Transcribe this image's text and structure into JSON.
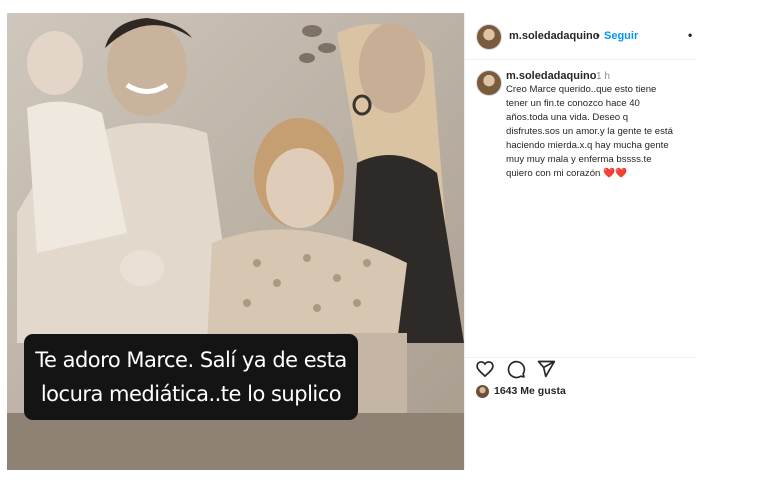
{
  "post": {
    "overlay_lines": [
      "Te adoro Marce. Salí ya de  esta",
      "locura mediática..te lo suplico"
    ]
  },
  "header": {
    "username": "m.soledadaquino",
    "separator": "•",
    "follow_label": "Seguir",
    "more_icon": "more-options-icon",
    "more_glyph": "•"
  },
  "comment": {
    "username": "m.soledadaquino",
    "time": "1 h",
    "text": "Creo Marce querido..que esto tiene\ntener un fin.te conozco hace 40\naños.toda una vida.  Deseo q\ndisfrutes.sos un amor.y la gente te está\nhaciendo mierda.x.q  hay mucha gente\nmuy muy mala y enferma bssss.te\nquiero con mi corazón",
    "emoji": "❤️❤️"
  },
  "actions": {
    "like_icon": "heart-icon",
    "comment_icon": "comment-icon",
    "share_icon": "send-icon"
  },
  "likes": {
    "count_label": "1643 Me gusta"
  },
  "colors": {
    "follow": "#0095f6",
    "text": "#262626",
    "muted": "#8e8e8e",
    "overlay_bg": "#141414"
  }
}
